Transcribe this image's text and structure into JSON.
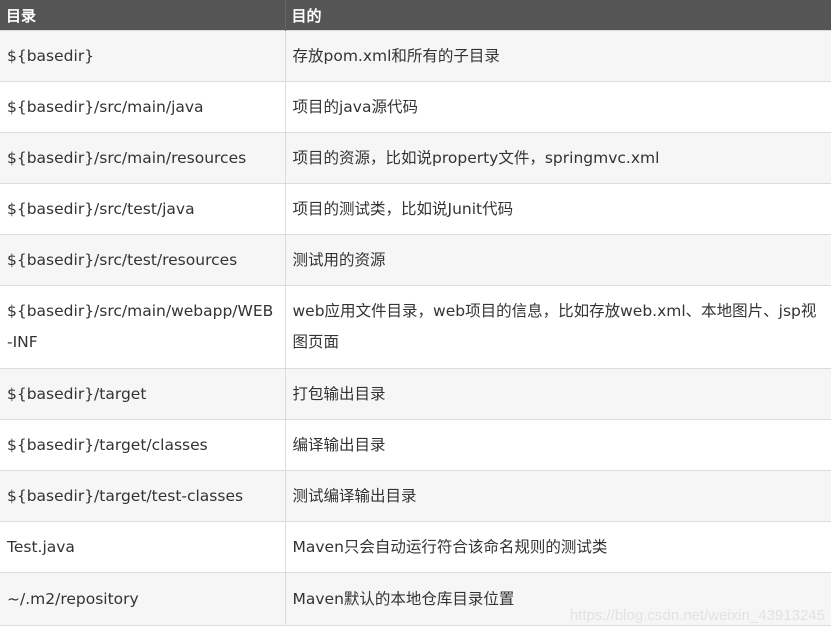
{
  "table": {
    "headers": [
      "目录",
      "目的"
    ],
    "rows": [
      [
        "${basedir}",
        "存放pom.xml和所有的子目录"
      ],
      [
        "${basedir}/src/main/java",
        "项目的java源代码"
      ],
      [
        "${basedir}/src/main/resources",
        "项目的资源，比如说property文件，springmvc.xml"
      ],
      [
        "${basedir}/src/test/java",
        "项目的测试类，比如说Junit代码"
      ],
      [
        "${basedir}/src/test/resources",
        "测试用的资源"
      ],
      [
        "${basedir}/src/main/webapp/WEB-INF",
        "web应用文件目录，web项目的信息，比如存放web.xml、本地图片、jsp视图页面"
      ],
      [
        "${basedir}/target",
        "打包输出目录"
      ],
      [
        "${basedir}/target/classes",
        "编译输出目录"
      ],
      [
        "${basedir}/target/test-classes",
        "测试编译输出目录"
      ],
      [
        "Test.java",
        "Maven只会自动运行符合该命名规则的测试类"
      ],
      [
        "~/.m2/repository",
        "Maven默认的本地仓库目录位置"
      ]
    ]
  },
  "watermark": "https://blog.csdn.net/weixin_43913245"
}
